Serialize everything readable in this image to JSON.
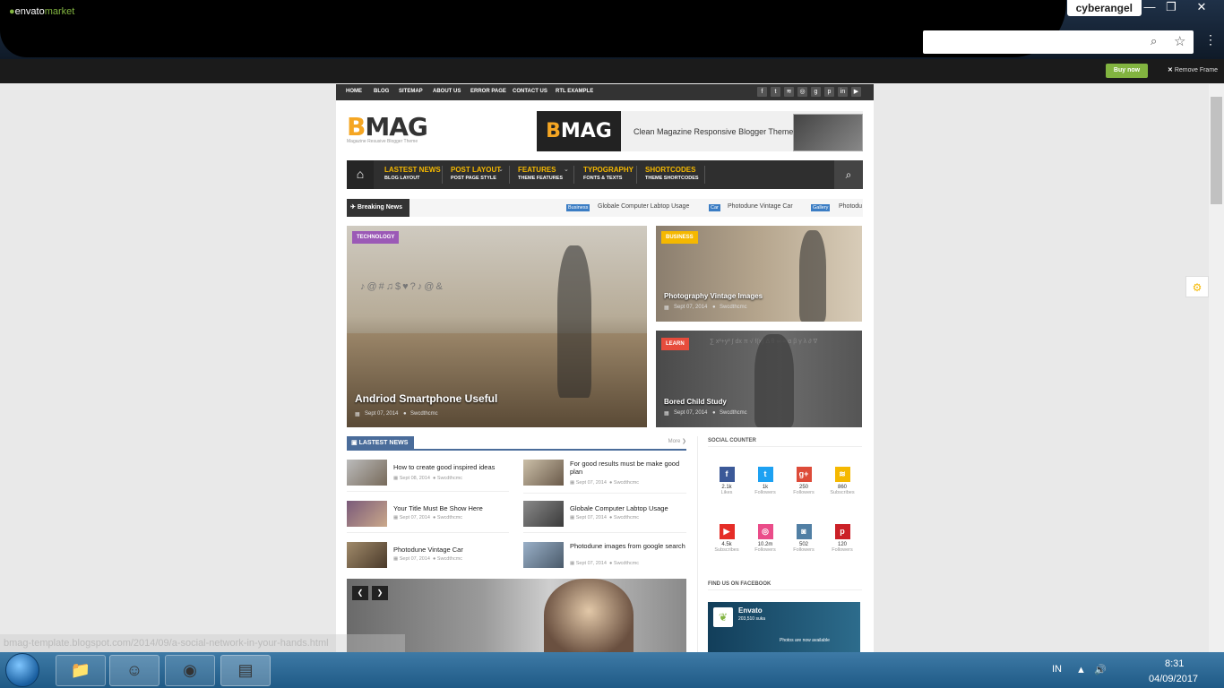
{
  "browser": {
    "profile_name": "cyberangel",
    "minimize": "—",
    "restore": "❐",
    "close": "✕"
  },
  "envato_bar": {
    "logo_a": "envato",
    "logo_b": "market",
    "buy_now": "Buy now",
    "remove_frame": "Remove Frame"
  },
  "top_nav": {
    "items": [
      "HOME",
      "BLOG",
      "SITEMAP",
      "ABOUT US",
      "ERROR PAGE",
      "CONTACT US",
      "RTL EXAMPLE"
    ],
    "social_icons": [
      "facebook-icon",
      "twitter-icon",
      "rss-icon",
      "dribbble-icon",
      "google-plus-icon",
      "pinterest-icon",
      "linkedin-icon",
      "youtube-icon"
    ],
    "social_glyphs": [
      "f",
      "t",
      "≋",
      "◎",
      "g",
      "p",
      "in",
      "▶"
    ]
  },
  "brand": {
    "logo_b": "B",
    "logo_rest": "MAG",
    "tagline": "Magazine Resusive Blogger Theme",
    "banner_b": "B",
    "banner_rest": "MAG",
    "banner_text": "Clean Magazine Responsive Blogger Theme"
  },
  "main_nav": {
    "items": [
      {
        "label": "LASTEST NEWS",
        "sub": "BLOG LAYOUT"
      },
      {
        "label": "POST LAYOUT",
        "sub": "POST PAGE STYLE"
      },
      {
        "label": "FEATURES",
        "sub": "THEME FEATURES"
      },
      {
        "label": "TYPOGRAPHY",
        "sub": "FONTS & TEXTS"
      },
      {
        "label": "SHORTCODES",
        "sub": "THEME SHORTCODES"
      }
    ]
  },
  "breaking": {
    "label": "Breaking News",
    "items": [
      {
        "tag": "Business",
        "title": "Globale Computer Labtop Usage"
      },
      {
        "tag": "Car",
        "title": "Photodune Vintage Car"
      },
      {
        "tag": "Gallery",
        "title": "Photodu"
      }
    ]
  },
  "featured": [
    {
      "category": "TECHNOLOGY",
      "category_color": "#9b59b6",
      "title": "Andriod Smartphone Useful",
      "date": "Sept 07, 2014",
      "author": "Swcdthcmc"
    },
    {
      "category": "BUSINESS",
      "category_color": "#f5b800",
      "title": "Photography Vintage Images",
      "date": "Sept 07, 2014",
      "author": "Swcdthcmc"
    },
    {
      "category": "LEARN",
      "category_color": "#e74c3c",
      "title": "Bored Child Study",
      "date": "Sept 07, 2014",
      "author": "Swcdthcmc"
    }
  ],
  "latest_news": {
    "label": "LASTEST NEWS",
    "more": "More ❯",
    "left": [
      {
        "title": "How to create good inspired ideas",
        "date": "Sept 08, 2014",
        "author": "Swcdthcmc"
      },
      {
        "title": "Your Title Must Be Show Here",
        "date": "Sept 07, 2014",
        "author": "Swcdthcmc"
      },
      {
        "title": "Photodune Vintage Car",
        "date": "Sept 07, 2014",
        "author": "Swcdthcmc"
      }
    ],
    "right": [
      {
        "title": "For good results must be make good plan",
        "date": "Sept 07, 2014",
        "author": "Swcdthcmc"
      },
      {
        "title": "Globale Computer Labtop Usage",
        "date": "Sept 07, 2014",
        "author": "Swcdthcmc"
      },
      {
        "title": "Photodune images from google search",
        "date": "Sept 07, 2014",
        "author": "Swcdthcmc"
      }
    ]
  },
  "slider": {
    "prev": "❮",
    "next": "❯"
  },
  "social_counter": {
    "label": "SOCIAL COUNTER",
    "items": [
      {
        "icon": "facebook-icon",
        "glyph": "f",
        "color": "#3b5998",
        "count": "2.1k",
        "label": "Likes"
      },
      {
        "icon": "twitter-icon",
        "glyph": "t",
        "color": "#1da1f2",
        "count": "1k",
        "label": "Followers"
      },
      {
        "icon": "google-plus-icon",
        "glyph": "g+",
        "color": "#dd4b39",
        "count": "250",
        "label": "Followers"
      },
      {
        "icon": "rss-icon",
        "glyph": "≋",
        "color": "#f5b800",
        "count": "860",
        "label": "Subscribes"
      },
      {
        "icon": "youtube-icon",
        "glyph": "▶",
        "color": "#e52d27",
        "count": "4.5k",
        "label": "Subscribes"
      },
      {
        "icon": "dribbble-icon",
        "glyph": "◎",
        "color": "#ea4c89",
        "count": "10.2m",
        "label": "Followers"
      },
      {
        "icon": "instagram-icon",
        "glyph": "◙",
        "color": "#517fa4",
        "count": "502",
        "label": "Followers"
      },
      {
        "icon": "pinterest-icon",
        "glyph": "p",
        "color": "#cb2027",
        "count": "120",
        "label": "Followers"
      }
    ]
  },
  "facebook": {
    "label": "FIND US ON FACEBOOK",
    "page_name": "Envato",
    "likes": "203,510 suka",
    "note": "Photos are now available"
  },
  "status_url": "bmag-template.blogspot.com/2014/09/a-social-network-in-your-hands.html",
  "taskbar": {
    "lang": "IN",
    "time": "8:31",
    "date": "04/09/2017"
  }
}
